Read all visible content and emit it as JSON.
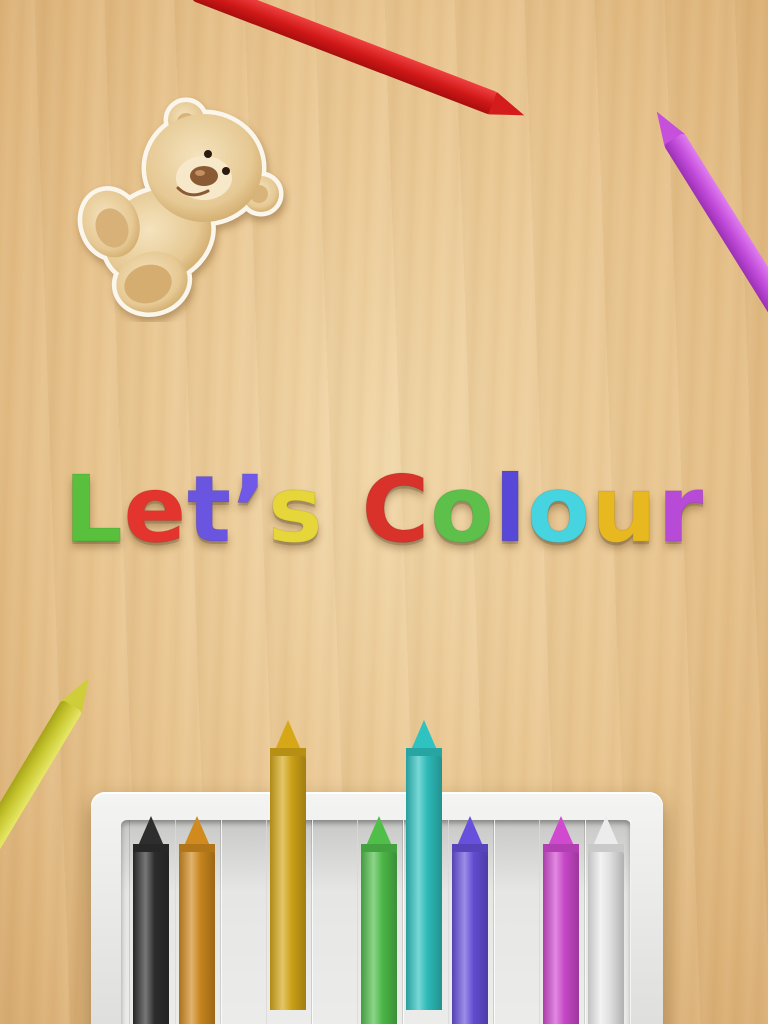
{
  "title": {
    "text": "Let's Colour",
    "letters": [
      {
        "char": "L",
        "color": "#58c03c"
      },
      {
        "char": "e",
        "color": "#e3352d"
      },
      {
        "char": "t",
        "color": "#6a55e0"
      },
      {
        "char": "’",
        "color": "#7058e8"
      },
      {
        "char": "s",
        "color": "#e6d63a"
      },
      {
        "char": " ",
        "color": ""
      },
      {
        "char": "C",
        "color": "#d8322a"
      },
      {
        "char": "o",
        "color": "#5cc04a"
      },
      {
        "char": "l",
        "color": "#5848d8"
      },
      {
        "char": "o",
        "color": "#46d4e0"
      },
      {
        "char": "u",
        "color": "#e8b820"
      },
      {
        "char": "r",
        "color": "#b84ad8"
      }
    ]
  },
  "teddy": {
    "icon": "teddy-bear-icon",
    "colors": {
      "fur": "#e8cf9c",
      "shade": "#c9a56c",
      "nose": "#8a5a34"
    }
  },
  "loose_crayons": [
    {
      "name": "red",
      "color": "#d01818"
    },
    {
      "name": "purple",
      "color": "#c04ad8"
    },
    {
      "name": "yellow",
      "color": "#c9c832"
    }
  ],
  "crayon_box": {
    "crayons": [
      {
        "name": "black",
        "color": "#2e2e2e",
        "raised": false
      },
      {
        "name": "orange",
        "color": "#d08a1e",
        "raised": false
      },
      {
        "name": "empty-slot",
        "color": "",
        "raised": false
      },
      {
        "name": "gold",
        "color": "#d6a818",
        "raised": true
      },
      {
        "name": "empty-slot",
        "color": "",
        "raised": false
      },
      {
        "name": "green",
        "color": "#4fbf4a",
        "raised": false
      },
      {
        "name": "teal",
        "color": "#2ec2c0",
        "raised": true
      },
      {
        "name": "blue-violet",
        "color": "#6650dc",
        "raised": false
      },
      {
        "name": "empty-slot",
        "color": "",
        "raised": false
      },
      {
        "name": "magenta",
        "color": "#d04ad0",
        "raised": false
      },
      {
        "name": "white",
        "color": "#ececec",
        "raised": false
      }
    ]
  }
}
